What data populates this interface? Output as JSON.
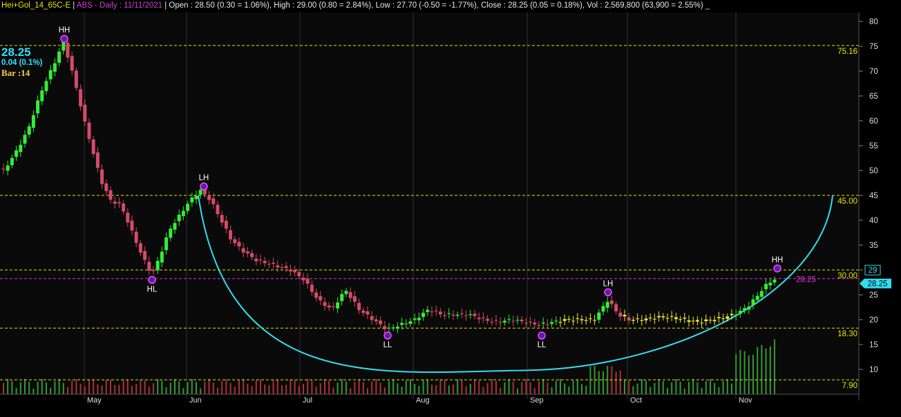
{
  "header": {
    "symbol": "Hei+Gol_14_65C-E",
    "separator": " | ",
    "study": "ABS - Daily : 11/11/2021",
    "open_label": "Open : 28.50 (0.30 = 1.06%),",
    "high_label": "High : 29.00 (0.80 = 2.84%),",
    "low_label": "Low : 27.70 (-0.50 = -1.77%),",
    "close_label": "Close : 28.25  (0.05 = 0.18%),",
    "vol_label": "Vol : 2,569,800  (63,900 = 2.55%)",
    "tail": " _"
  },
  "overlay": {
    "last_price": "28.25",
    "last_change": "0.04 (0.1%)",
    "bar_label": "Bar :14"
  },
  "colors": {
    "background": "#000000",
    "up_candle": "#33ee33",
    "down_candle": "#d64a6a",
    "neutral_candle": "#eeee33",
    "arc": "#33ddee",
    "level_line": "#e8e800",
    "price_line": "#dd33dd",
    "grid": "#333333"
  },
  "chart_data": {
    "type": "candlestick",
    "y_axis": {
      "min": 5,
      "max": 82,
      "ticks": [
        80,
        75,
        70,
        65,
        60,
        55,
        50,
        45,
        40,
        35,
        30,
        25,
        20,
        15,
        10
      ]
    },
    "x_axis": {
      "labels": [
        "May",
        "Jun",
        "Jul",
        "Aug",
        "Sep",
        "Oct",
        "Nov"
      ]
    },
    "horizontal_levels": [
      {
        "value": 75.16,
        "label": "75.16"
      },
      {
        "value": 45.0,
        "label": "45.00"
      },
      {
        "value": 30.0,
        "label": "30.00"
      },
      {
        "value": 18.3,
        "label": "18.30"
      },
      {
        "value": 7.9,
        "label": "7.90"
      }
    ],
    "price_line": {
      "value": 28.25,
      "label": "28.25"
    },
    "price_tags": [
      {
        "value": 29,
        "label": "29",
        "style": "outline"
      },
      {
        "value": 28.25,
        "label": "28.25",
        "style": "filled"
      }
    ],
    "swing_labels": [
      {
        "label": "HH",
        "price": 76.5,
        "pos": "above"
      },
      {
        "label": "HL",
        "price": 28.0,
        "pos": "below"
      },
      {
        "label": "LH",
        "price": 46.8,
        "pos": "above"
      },
      {
        "label": "LL",
        "price": 16.8,
        "pos": "below"
      },
      {
        "label": "LL",
        "price": 16.8,
        "pos": "below"
      },
      {
        "label": "LH",
        "price": 25.5,
        "pos": "above"
      },
      {
        "label": "HH",
        "price": 30.3,
        "pos": "above"
      }
    ],
    "arc_bottom": 9.8
  }
}
